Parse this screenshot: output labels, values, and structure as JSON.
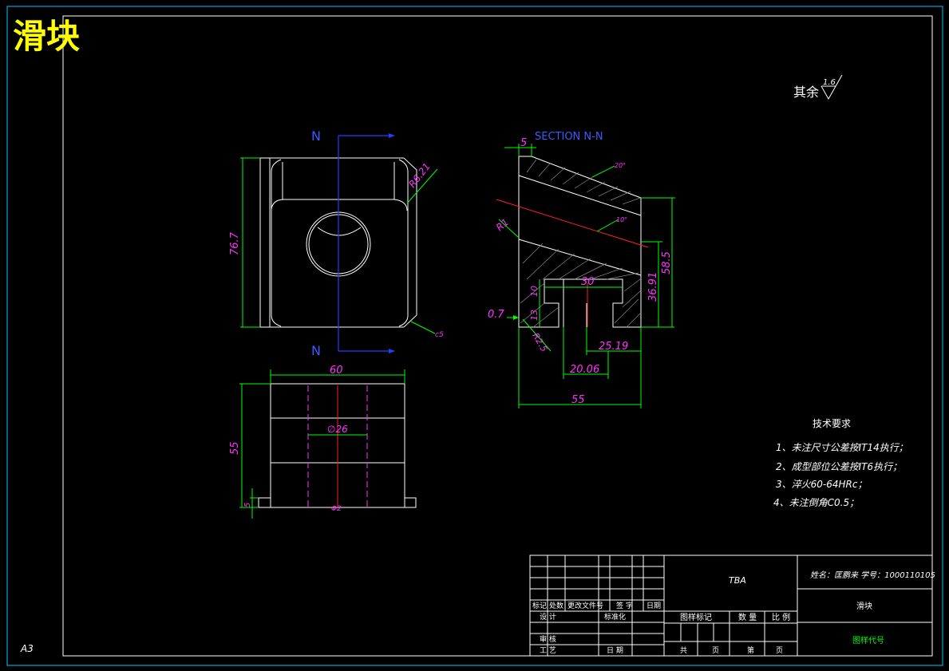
{
  "title": "滑块",
  "sheet_size": "A3",
  "surface_finish": {
    "label": "其余",
    "value": "1.6"
  },
  "section": {
    "label": "SECTION N-N",
    "cut_letter_top": "N",
    "cut_letter_bottom": "N"
  },
  "front_view_dims": {
    "height": "76.7",
    "chamfer": "R6.21",
    "edge": "c5"
  },
  "top_view_dims": {
    "width": "60",
    "height": "55",
    "bore": "∅26",
    "step": "5",
    "bottom_label": "Φ2"
  },
  "section_view_dims": {
    "top_offset": "5",
    "angle_top": "20°",
    "angle_mid": "10°",
    "radius_1": "R1",
    "width_30": "30",
    "dim_10": "10",
    "dim_13": "13",
    "dim_07": "0.7",
    "radius_25": "R2.5",
    "dim_2519": "25.19",
    "dim_2006": "20.06",
    "dim_55": "55",
    "dim_3691": "36.91",
    "dim_585": "58.5"
  },
  "tech_requirements": {
    "heading": "技术要求",
    "items": [
      "1、未注尺寸公差按IT14执行；",
      "2、成型部位公差按IT6执行；",
      "3、淬火60-64HRc；",
      "4、未注倒角C0.5；"
    ]
  },
  "title_block": {
    "tba": "TBA",
    "student": "姓名：匡鹏来 学号：1000110105",
    "part_name": "滑块",
    "drawing_code": "图样代号",
    "headers": [
      "标记",
      "处数",
      "更改文件号",
      "签 字",
      "日期"
    ],
    "roles": [
      "设 计",
      "标准化",
      "审 核",
      "工 艺",
      "日 期"
    ],
    "stage_labels": [
      "图样标记",
      "数 量",
      "比 例"
    ],
    "sheet_labels": [
      "共",
      "页",
      "第",
      "页"
    ]
  }
}
